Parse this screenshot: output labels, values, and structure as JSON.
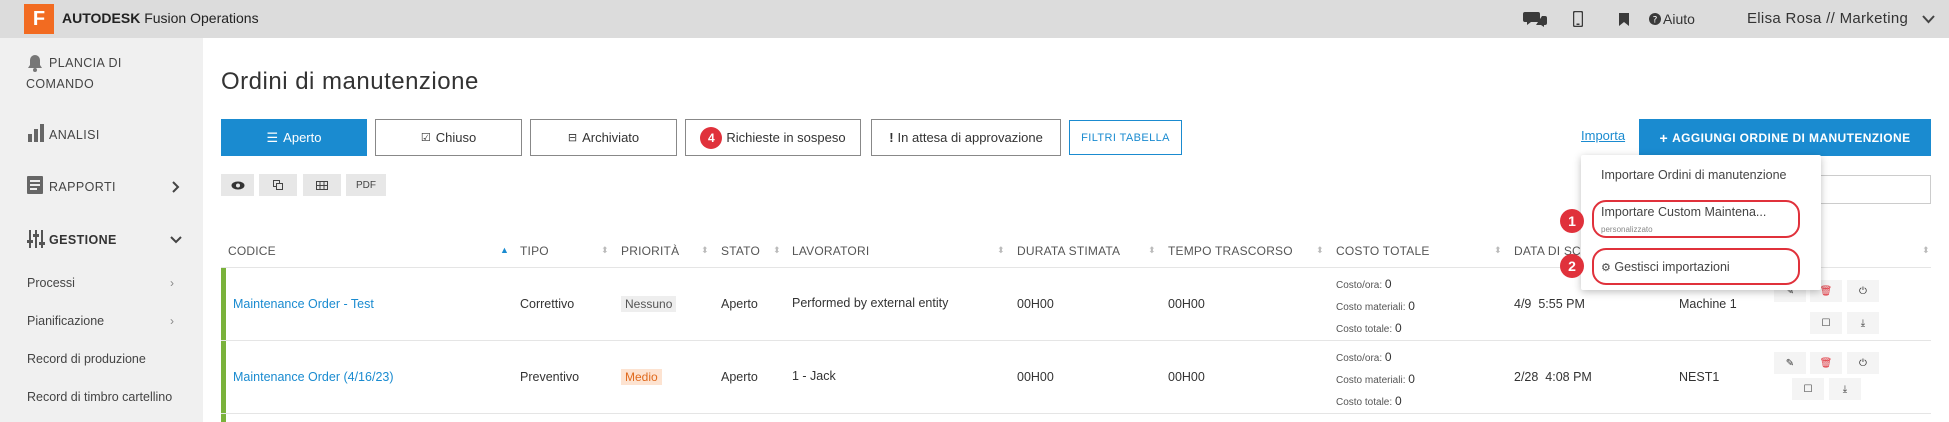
{
  "topbar": {
    "logo_letter": "F",
    "brand_bold": "AUTODESK",
    "brand_rest": " Fusion Operations",
    "help": "Aiuto",
    "user": "Elisa Rosa // Marketing"
  },
  "sidebar": {
    "dashboard_line1": "PLANCIA DI",
    "dashboard_line2": "COMANDO",
    "analytics": "ANALISI",
    "reports": "RAPPORTI",
    "management": "GESTIONE",
    "sub": [
      "Processi",
      "Pianificazione",
      "Record di produzione",
      "Record di timbro cartellino"
    ]
  },
  "main": {
    "title": "Ordini di manutenzione",
    "tabs": [
      {
        "label": "Aperto"
      },
      {
        "label": "Chiuso"
      },
      {
        "label": "Archiviato"
      },
      {
        "label": "Richieste in sospeso",
        "badge": "4"
      },
      {
        "label": "In attesa di approvazione"
      }
    ],
    "filters": "FILTRI TABELLA",
    "import": "Importa",
    "add": "AGGIUNGI ORDINE DI MANUTENZIONE",
    "pdf": "PDF"
  },
  "table": {
    "headers": [
      "CODICE",
      "TIPO",
      "PRIORITÀ",
      "STATO",
      "LAVORATORI",
      "DURATA STIMATA",
      "TEMPO TRASCORSO",
      "COSTO TOTALE",
      "DATA DI SCA"
    ],
    "cost_labels": [
      "Costo/ora:",
      "Costo materiali:",
      "Costo totale:"
    ],
    "rows": [
      {
        "code": "Maintenance Order - Test",
        "type": "Correttivo",
        "priority": "Nessuno",
        "status": "Aperto",
        "workers": "Performed by external entity",
        "estimate": "00H00",
        "elapsed": "00H00",
        "costs": [
          "0",
          "0",
          "0"
        ],
        "date": "4/9",
        "time": "5:55 PM",
        "machine": "Machine 1"
      },
      {
        "code": "Maintenance Order (4/16/23)",
        "type": "Preventivo",
        "priority": "Medio",
        "status": "Aperto",
        "workers": "1 - Jack",
        "estimate": "00H00",
        "elapsed": "00H00",
        "costs": [
          "0",
          "0",
          "0"
        ],
        "date": "2/28",
        "time": "4:08 PM",
        "machine": "NEST1"
      }
    ]
  },
  "dropdown": {
    "item1": "Importare Ordini di manutenzione",
    "item2": "Importare Custom Maintena...",
    "item2_sub": "personalizzato",
    "item3": "Gestisci importazioni",
    "callouts": [
      "1",
      "2"
    ]
  },
  "colors": {
    "accent": "#1a8bd0",
    "brand": "#f26b21",
    "callout": "#e0313b",
    "row_bar": "#7ab23b"
  }
}
